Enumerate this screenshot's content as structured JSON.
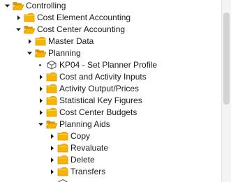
{
  "tree": {
    "items": [
      {
        "label": "Controlling",
        "level": 0,
        "state": "expanded",
        "icon": "folder-open-icon"
      },
      {
        "label": "Cost Element Accounting",
        "level": 1,
        "state": "collapsed",
        "icon": "folder-icon"
      },
      {
        "label": "Cost Center Accounting",
        "level": 1,
        "state": "expanded",
        "icon": "folder-open-icon"
      },
      {
        "label": "Master Data",
        "level": 2,
        "state": "collapsed",
        "icon": "folder-icon"
      },
      {
        "label": "Planning",
        "level": 2,
        "state": "expanded",
        "icon": "folder-open-icon"
      },
      {
        "label": "KP04 - Set Planner Profile",
        "level": 3,
        "state": "leaf",
        "icon": "transaction-cube-icon"
      },
      {
        "label": "Cost and Activity Inputs",
        "level": 3,
        "state": "collapsed",
        "icon": "folder-icon"
      },
      {
        "label": "Activity Output/Prices",
        "level": 3,
        "state": "collapsed",
        "icon": "folder-icon"
      },
      {
        "label": "Statistical Key Figures",
        "level": 3,
        "state": "collapsed",
        "icon": "folder-icon"
      },
      {
        "label": "Cost Center Budgets",
        "level": 3,
        "state": "collapsed",
        "icon": "folder-icon"
      },
      {
        "label": "Planning Aids",
        "level": 3,
        "state": "expanded",
        "icon": "folder-open-icon"
      },
      {
        "label": "Copy",
        "level": 4,
        "state": "collapsed",
        "icon": "folder-icon"
      },
      {
        "label": "Revaluate",
        "level": 4,
        "state": "collapsed",
        "icon": "folder-icon"
      },
      {
        "label": "Delete",
        "level": 4,
        "state": "collapsed",
        "icon": "folder-icon"
      },
      {
        "label": "Transfers",
        "level": 4,
        "state": "collapsed",
        "icon": "folder-icon"
      },
      {
        "label": "",
        "level": 4,
        "state": "leaf",
        "icon": "transaction-cube-icon"
      }
    ]
  },
  "colors": {
    "folder_fill": "#f7b500",
    "folder_dark": "#d89400",
    "folder_inner": "#ffd45a",
    "arrow": "#1a1a1a",
    "cube": "#555555"
  }
}
